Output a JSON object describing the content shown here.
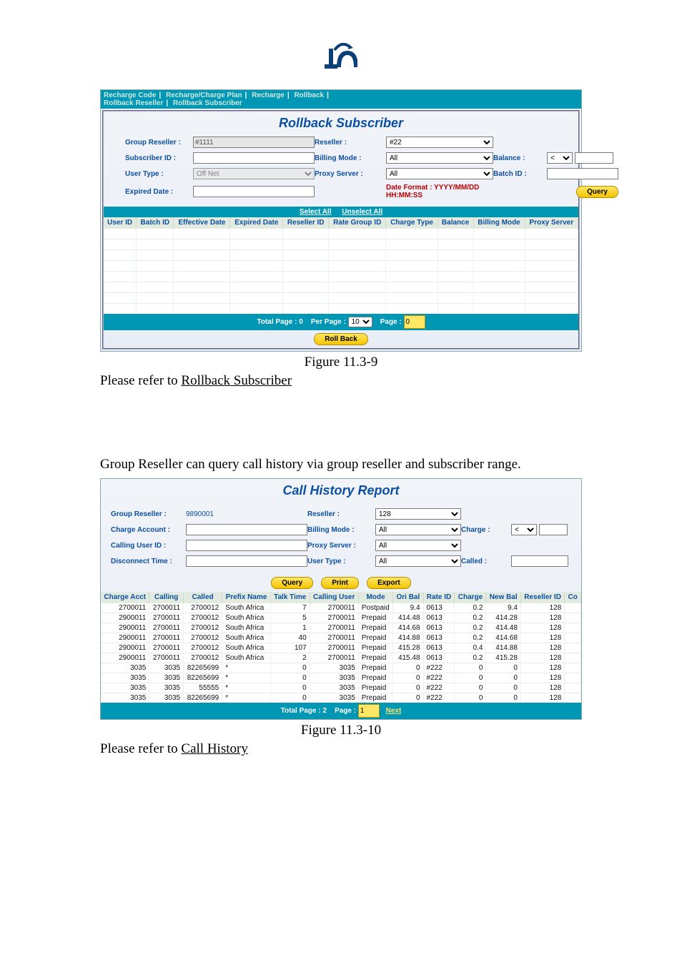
{
  "figure1": {
    "tabs": [
      "Recharge Code",
      "Recharge/Charge Plan",
      "Recharge",
      "Rollback",
      "Rollback Reseller",
      "Rollback Subscriber"
    ],
    "title": "Rollback Subscriber",
    "labels": {
      "group_reseller": "Group Reseller :",
      "reseller": "Reseller :",
      "subscriber_id": "Subscriber ID :",
      "billing_mode": "Billing Mode :",
      "balance": "Balance :",
      "user_type": "User Type :",
      "proxy_server": "Proxy Server :",
      "batch_id": "Batch ID :",
      "expired_date": "Expired Date :",
      "date_format": "Date Format : YYYY/MM/DD HH:MM:SS"
    },
    "values": {
      "group_reseller": "#1111",
      "reseller": "#22",
      "billing_mode": "All",
      "balance_op": "<",
      "user_type": "Off Net",
      "proxy_server": "All",
      "per_page": "10",
      "page": "0",
      "total_page_label": "Total Page : 0",
      "per_page_label": "Per Page :",
      "page_label": "Page :"
    },
    "buttons": {
      "query": "Query",
      "select_all": "Select All",
      "unselect_all": "Unselect All",
      "rollback": "Roll Back"
    },
    "columns": [
      "User ID",
      "Batch ID",
      "Effective Date",
      "Expired Date",
      "Reseller ID",
      "Rate Group ID",
      "Charge Type",
      "Balance",
      "Billing Mode",
      "Proxy Server"
    ],
    "caption": "Figure 11.3-9",
    "refer_text_pre": "Please refer to ",
    "refer_link": "Rollback Subscriber"
  },
  "mid_text": "Group Reseller can query call history via group reseller and subscriber range.",
  "figure2": {
    "title": "Call History Report",
    "labels": {
      "group_reseller": "Group Reseller :",
      "reseller": "Reseller :",
      "charge_account": "Charge Account :",
      "billing_mode": "Billing Mode :",
      "charge": "Charge :",
      "calling_user_id": "Calling User ID :",
      "proxy_server": "Proxy Server :",
      "disconnect_time": "Disconnect Time :",
      "user_type": "User Type :",
      "called": "Called :"
    },
    "values": {
      "group_reseller": "9890001",
      "reseller": "128",
      "billing_mode": "All",
      "charge_op": "<",
      "proxy_server": "All",
      "user_type": "All",
      "total_page_label": "Total Page : 2",
      "page_label": "Page :",
      "page": "1",
      "next": "Next"
    },
    "buttons": {
      "query": "Query",
      "print": "Print",
      "export": "Export"
    },
    "columns": [
      "Charge Acct",
      "Calling",
      "Called",
      "Prefix Name",
      "Talk Time",
      "Calling User",
      "Mode",
      "Ori Bal",
      "Rate ID",
      "Charge",
      "New Bal",
      "Reseller ID",
      "Co"
    ],
    "rows": [
      {
        "charge_acct": "2700011",
        "calling": "2700011",
        "called": "2700012",
        "prefix": "South Africa",
        "talk": "7",
        "cuser": "2700011",
        "mode": "Postpaid",
        "ori": "9.4",
        "rate": "0613",
        "charge": "0.2",
        "newbal": "9.4",
        "res": "128"
      },
      {
        "charge_acct": "2900011",
        "calling": "2700011",
        "called": "2700012",
        "prefix": "South Africa",
        "talk": "5",
        "cuser": "2700011",
        "mode": "Prepaid",
        "ori": "414.48",
        "rate": "0613",
        "charge": "0.2",
        "newbal": "414.28",
        "res": "128"
      },
      {
        "charge_acct": "2900011",
        "calling": "2700011",
        "called": "2700012",
        "prefix": "South Africa",
        "talk": "1",
        "cuser": "2700011",
        "mode": "Prepaid",
        "ori": "414.68",
        "rate": "0613",
        "charge": "0.2",
        "newbal": "414.48",
        "res": "128"
      },
      {
        "charge_acct": "2900011",
        "calling": "2700011",
        "called": "2700012",
        "prefix": "South Africa",
        "talk": "40",
        "cuser": "2700011",
        "mode": "Prepaid",
        "ori": "414.88",
        "rate": "0613",
        "charge": "0.2",
        "newbal": "414.68",
        "res": "128"
      },
      {
        "charge_acct": "2900011",
        "calling": "2700011",
        "called": "2700012",
        "prefix": "South Africa",
        "talk": "107",
        "cuser": "2700011",
        "mode": "Prepaid",
        "ori": "415.28",
        "rate": "0613",
        "charge": "0.4",
        "newbal": "414.88",
        "res": "128"
      },
      {
        "charge_acct": "2900011",
        "calling": "2700011",
        "called": "2700012",
        "prefix": "South Africa",
        "talk": "2",
        "cuser": "2700011",
        "mode": "Prepaid",
        "ori": "415.48",
        "rate": "0613",
        "charge": "0.2",
        "newbal": "415.28",
        "res": "128"
      },
      {
        "charge_acct": "3035",
        "calling": "3035",
        "called": "82265699",
        "prefix": "*",
        "talk": "0",
        "cuser": "3035",
        "mode": "Prepaid",
        "ori": "0",
        "rate": "#222",
        "charge": "0",
        "newbal": "0",
        "res": "128"
      },
      {
        "charge_acct": "3035",
        "calling": "3035",
        "called": "82265699",
        "prefix": "*",
        "talk": "0",
        "cuser": "3035",
        "mode": "Prepaid",
        "ori": "0",
        "rate": "#222",
        "charge": "0",
        "newbal": "0",
        "res": "128"
      },
      {
        "charge_acct": "3035",
        "calling": "3035",
        "called": "55555",
        "prefix": "*",
        "talk": "0",
        "cuser": "3035",
        "mode": "Prepaid",
        "ori": "0",
        "rate": "#222",
        "charge": "0",
        "newbal": "0",
        "res": "128"
      },
      {
        "charge_acct": "3035",
        "calling": "3035",
        "called": "82265699",
        "prefix": "*",
        "talk": "0",
        "cuser": "3035",
        "mode": "Prepaid",
        "ori": "0",
        "rate": "#222",
        "charge": "0",
        "newbal": "0",
        "res": "128"
      }
    ],
    "caption": "Figure 11.3-10",
    "refer_text_pre": "Please refer to ",
    "refer_link": "Call History"
  }
}
